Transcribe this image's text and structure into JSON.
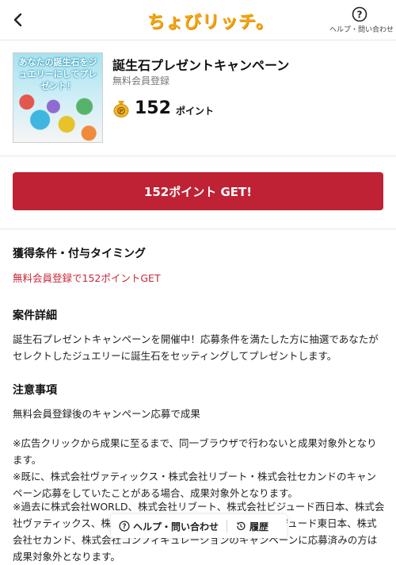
{
  "header": {
    "logo_text": "ちょびリッチ。",
    "help_label": "ヘルプ・問い合わせ"
  },
  "campaign": {
    "thumbnail_text": "あなたの誕生石をジュエリーにしてプレゼント！",
    "title": "誕生石プレゼントキャンペーン",
    "subtitle": "無料会員登録",
    "points": "152",
    "points_unit": "ポイント"
  },
  "cta": {
    "label": "152ポイント GET!"
  },
  "conditions": {
    "heading": "獲得条件・付与タイミング",
    "text": "無料会員登録で152ポイントGET"
  },
  "details": {
    "heading": "案件詳細",
    "text": "誕生石プレゼントキャンペーンを開催中！応募条件を満たした方に抽選であなたがセレクトしたジュエリーに誕生石をセッティングしてプレゼントします。"
  },
  "notes": {
    "heading": "注意事項",
    "line1": "無料会員登録後のキャンペーン応募で成果",
    "line2": "※広告クリックから成果に至るまで、同一ブラウザで行わないと成果対象外となります。",
    "line3": "※既に、株式会社ヴァティックス・株式会社リブート・株式会社セカンドのキャンペーン応募をしていたことがある場合、成果対象外となります。",
    "line4": "※過去に株式会社WORLD、株式会社リブート、株式会社ビジュード西日本、株式会社ヴァティックス、株式会社ビジュード中日本、株式会社ビジュード東日本、株式会社セカンド、株式会社コンフィギュレーションのキャンペーンに応募済みの方は成果対象外となります。"
  },
  "bottom_bar": {
    "help_label": "ヘルプ・問い合わせ",
    "history_label": "履歴"
  },
  "colors": {
    "accent_red": "#be2234",
    "logo_orange": "#f2a516"
  }
}
